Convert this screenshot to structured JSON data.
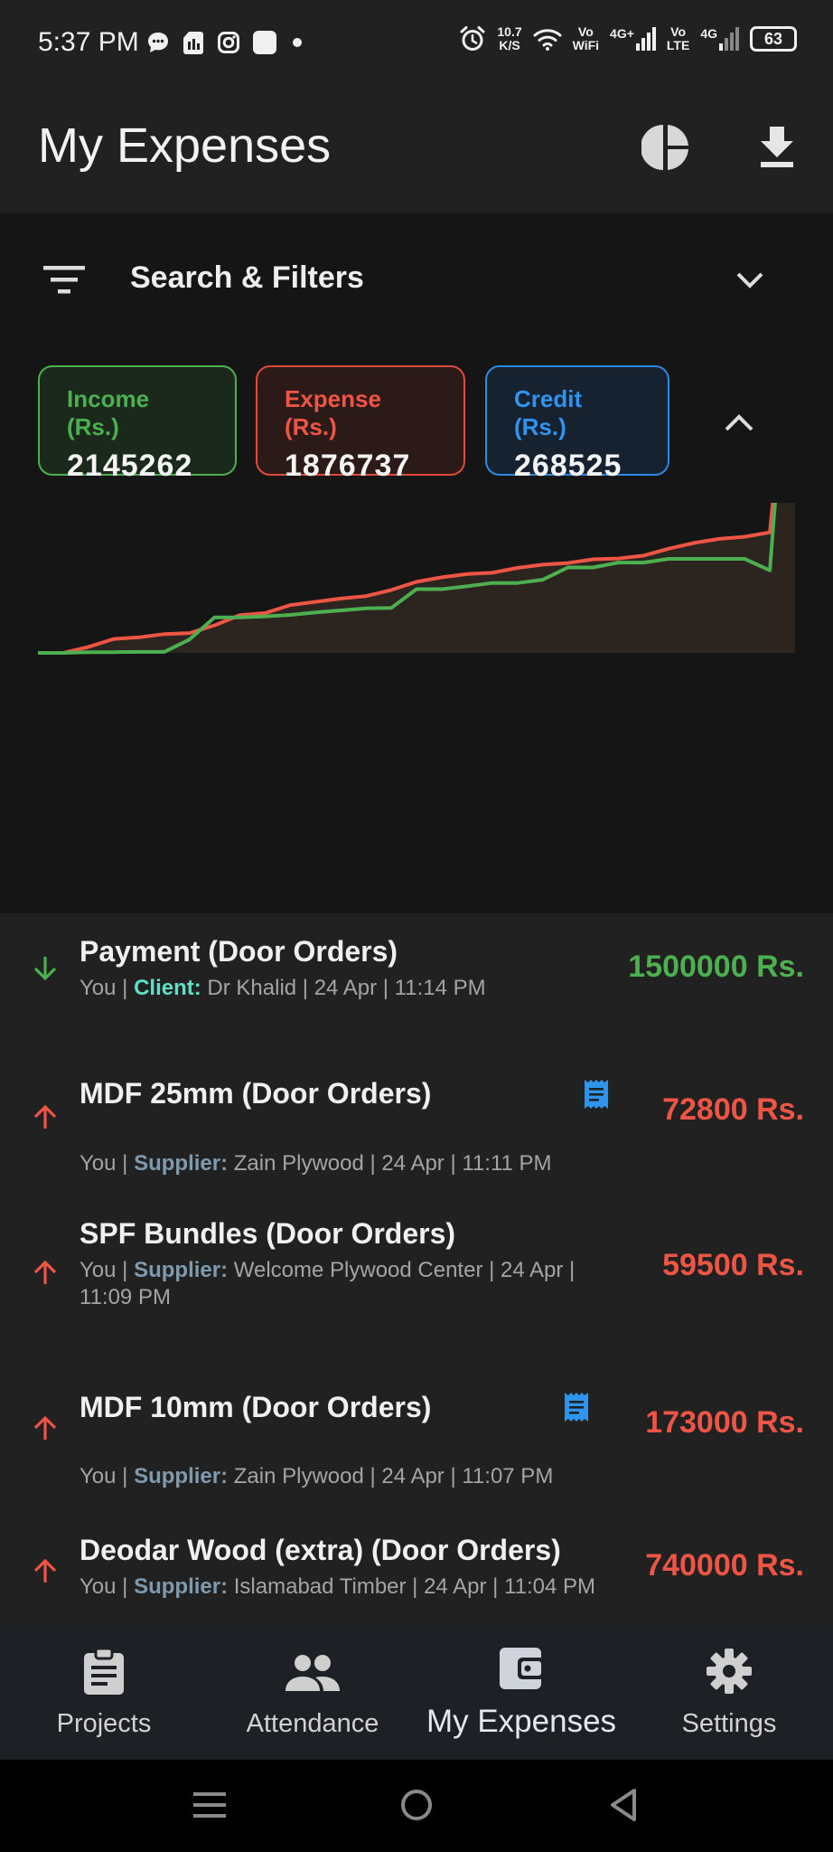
{
  "status_bar": {
    "time": "5:37 PM",
    "net_speed_value": "10.7",
    "net_speed_unit": "K/S",
    "sim1_label_top": "Vo",
    "sim1_label_bottom": "WiFi",
    "sim1_network": "4G+",
    "sim2_label_top": "Vo",
    "sim2_label_bottom": "LTE",
    "sim2_network": "4G",
    "battery": "63"
  },
  "app_bar": {
    "title": "My Expenses",
    "chart_icon": "pie-chart-icon",
    "download_icon": "download-icon"
  },
  "filters": {
    "label": "Search & Filters",
    "icon": "filter-list-icon"
  },
  "summary": {
    "income_label": "Income (Rs.)",
    "income_value": "2145262",
    "expense_label": "Expense (Rs.)",
    "expense_value": "1876737",
    "credit_label": "Credit (Rs.)",
    "credit_value": "268525"
  },
  "colors": {
    "income": "#4caf50",
    "expense": "#ef5545",
    "credit": "#2f94ee",
    "client_role": "#5fe0c4",
    "supplier_role": "#7f9aae"
  },
  "chart_data": {
    "type": "line",
    "title": "",
    "xlabel": "",
    "ylabel": "",
    "grid": false,
    "legend": "none",
    "series": [
      {
        "color": "#4caf50",
        "values": [
          0.0,
          0.0,
          0.00176,
          0.00176,
          0.00237,
          0.00237,
          0.0326,
          0.087,
          0.087,
          0.0894,
          0.0929,
          0.0989,
          0.104,
          0.109,
          0.11,
          0.156,
          0.156,
          0.163,
          0.171,
          0.171,
          0.179,
          0.209,
          0.209,
          0.221,
          0.221,
          0.23,
          0.23,
          0.23,
          0.23,
          0.202,
          1.0
        ]
      },
      {
        "color": "#ef5545",
        "values": [
          0.0,
          0.0,
          0.0145,
          0.034,
          0.0381,
          0.046,
          0.0485,
          0.0675,
          0.0924,
          0.0974,
          0.117,
          0.125,
          0.133,
          0.139,
          0.154,
          0.174,
          0.185,
          0.193,
          0.196,
          0.208,
          0.216,
          0.22,
          0.229,
          0.231,
          0.238,
          0.255,
          0.269,
          0.279,
          0.284,
          0.295,
          0.922
        ]
      }
    ]
  },
  "transactions": [
    {
      "direction": "in",
      "title": "Payment (Door Orders)",
      "who": "You | ",
      "role": "Client:",
      "meta_rest": " Dr Khalid | 24 Apr | 11:14 PM",
      "amount": "1500000 Rs."
    },
    {
      "direction": "out",
      "title": "MDF 25mm (Door Orders)",
      "who": "You | ",
      "role": "Supplier:",
      "meta_rest": " Zain Plywood | 24 Apr | 11:11 PM",
      "amount": "72800 Rs.",
      "has_receipt": "receipt-icon"
    },
    {
      "direction": "out",
      "title": "SPF Bundles (Door Orders)",
      "who": "You | ",
      "role": "Supplier:",
      "meta_rest": " Welcome Plywood Center | 24 Apr |",
      "meta_line2": "11:09 PM",
      "amount": "59500 Rs."
    },
    {
      "direction": "out",
      "title": "MDF 10mm (Door Orders)",
      "who": "You | ",
      "role": "Supplier:",
      "meta_rest": " Zain Plywood | 24 Apr | 11:07 PM",
      "amount": "173000 Rs.",
      "has_receipt": "receipt-icon"
    },
    {
      "direction": "out",
      "title": "Deodar Wood (extra) (Door Orders)",
      "who": "You | ",
      "role": "Supplier:",
      "meta_rest": " Islamabad Timber | 24 Apr | 11:04 PM",
      "amount": "740000 Rs."
    }
  ],
  "bottom_nav": {
    "items": [
      {
        "label": "Projects",
        "icon": "clipboard-icon"
      },
      {
        "label": "Attendance",
        "icon": "people-icon"
      },
      {
        "label": "My Expenses",
        "icon": "wallet-icon",
        "active": true
      },
      {
        "label": "Settings",
        "icon": "gear-icon"
      }
    ]
  }
}
